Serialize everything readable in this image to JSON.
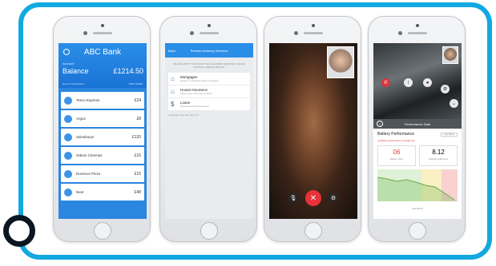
{
  "colors": {
    "frame": "#12a8e0",
    "bank_blue": "#2a8ee8",
    "end_call": "#e8323a",
    "warning": "#e0402c"
  },
  "bank": {
    "title": "ABC Bank",
    "subtitle": "Account",
    "balance_label": "Balance",
    "balance_value": "£1214.50",
    "recent_label": "Recent Transactions",
    "recent_right": "VIEW MORE",
    "transactions": [
      {
        "name": "Tesco Express",
        "amount": "£24"
      },
      {
        "name": "Argos",
        "amount": "£8"
      },
      {
        "name": "Sainsburys",
        "amount": "£120"
      },
      {
        "name": "Odeon Cinemas",
        "amount": "£16"
      },
      {
        "name": "Dominos Pizza",
        "amount": "£15"
      },
      {
        "name": "Next",
        "amount": "£48"
      }
    ]
  },
  "advisory": {
    "back": "Back",
    "title": "Remote Advisory Services",
    "intro": "WE ARE HAPPY TO DISCUSS THE FOLLOWING SERVICES. PLEASE CHOOSE A SERVICE BELOW.",
    "services": [
      {
        "icon": "home-icon",
        "title": "Mortgages",
        "desc": "Speak to a specialist about mortgages"
      },
      {
        "icon": "house-insurance-icon",
        "title": "House Insurance",
        "desc": "Protect your home and contents"
      },
      {
        "icon": "loans-icon",
        "title": "Loans",
        "desc": "Personal and business loans"
      }
    ],
    "footer": "Availability: 9am–5pm Mon–Fri"
  },
  "video_call": {
    "end_icon": "close-icon",
    "mute_icon": "microphone-icon",
    "settings_icon": "gear-icon"
  },
  "performance": {
    "bar_title": "Performance Data",
    "card_title": "Battery Performance",
    "select_label": "Last Month",
    "warning": "Battery performance unusually low",
    "metrics": [
      {
        "value": "06",
        "label": "Battery Volts"
      },
      {
        "value": "8.12",
        "label": "Capacity (kWhours)"
      }
    ],
    "chart_caption": "Past Month"
  }
}
